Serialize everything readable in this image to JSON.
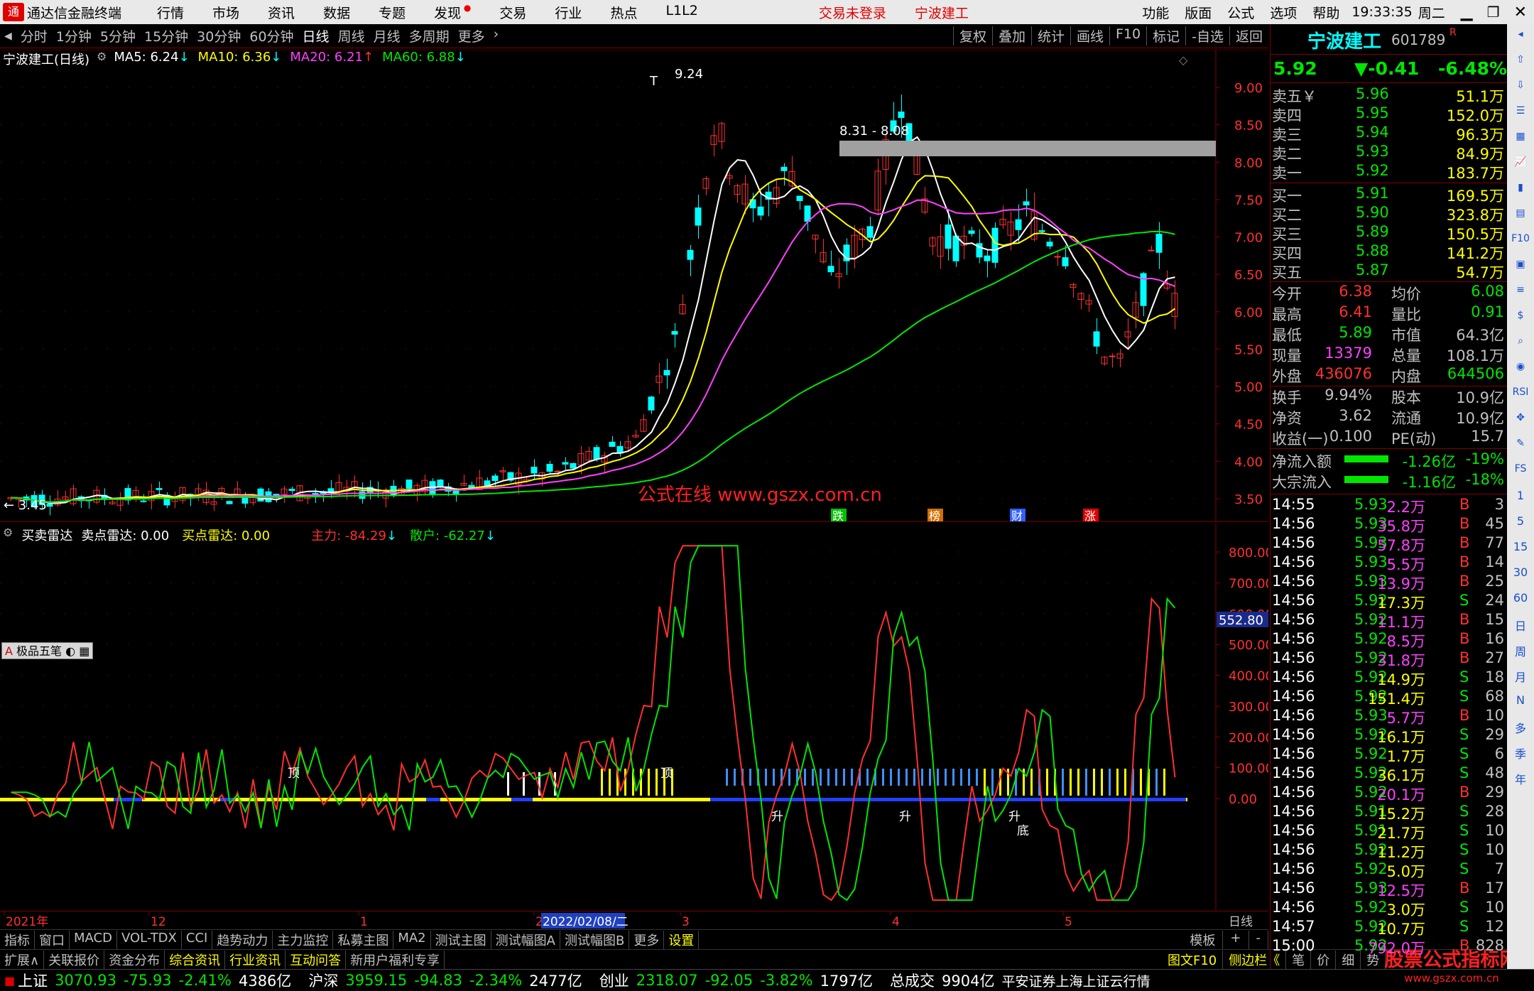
{
  "app": {
    "title": "通达信金融终端",
    "logo_icon": "tdx-logo-icon"
  },
  "menu": [
    "行情",
    "市场",
    "资讯",
    "数据",
    "专题",
    "发现",
    "交易",
    "行业",
    "热点",
    "L1L2"
  ],
  "menu_center": {
    "trade_status": "交易未登录",
    "stock_name": "宁波建工"
  },
  "menu_right": [
    "功能",
    "版面",
    "公式",
    "选项",
    "帮助"
  ],
  "clock": {
    "time": "19:33:35",
    "weekday": "周二"
  },
  "periods": [
    "分时",
    "1分钟",
    "5分钟",
    "15分钟",
    "30分钟",
    "60分钟",
    "日线",
    "周线",
    "月线",
    "多周期",
    "更多"
  ],
  "active_period": "日线",
  "toolbar_right": [
    "复权",
    "叠加",
    "统计",
    "画线",
    "F10",
    "标记",
    "-自选",
    "返回"
  ],
  "main_chart": {
    "title": "宁波建工(日线)",
    "ma_labels": [
      {
        "text": "MA5: 6.24",
        "color": "#ffffff"
      },
      {
        "text": "MA10: 6.36",
        "color": "#ffff00"
      },
      {
        "text": "MA20: 6.21",
        "color": "#ff40ff"
      },
      {
        "text": "MA60: 6.88",
        "color": "#00e600"
      }
    ],
    "y_ticks": [
      "9.00",
      "8.50",
      "8.00",
      "7.50",
      "7.00",
      "6.50",
      "6.00",
      "5.50",
      "5.00",
      "4.50",
      "4.00",
      "3.50"
    ],
    "annotations": {
      "high": "9.24",
      "low": "3.45",
      "range": "8.31 - 8.08",
      "watermark": "公式在线  www.gszx.com.cn"
    },
    "events": [
      {
        "text": "跌",
        "color": "#00c000"
      },
      {
        "text": "榜",
        "color": "#d07000"
      },
      {
        "text": "财",
        "color": "#3060ff"
      },
      {
        "text": "涨",
        "color": "#e00000"
      }
    ]
  },
  "sub_chart": {
    "title": "买卖雷达",
    "labels": [
      {
        "text": "卖点雷达: 0.00",
        "color": "#ffffff"
      },
      {
        "text": "买点雷达: 0.00",
        "color": "#ffff00"
      },
      {
        "text": "主力: -84.29",
        "color": "#ff3030"
      },
      {
        "text": "散户: -62.27",
        "color": "#00e600"
      }
    ],
    "y_ticks": [
      "800.00",
      "700.00",
      "600.00",
      "500.00",
      "400.00",
      "300.00",
      "200.00",
      "100.00",
      "0.00"
    ],
    "current_value": "552.80",
    "tool_label": "极品五笔",
    "marks": {
      "top": "顶",
      "up": "升",
      "bottom": "底"
    }
  },
  "date_axis": [
    "2021年",
    "12",
    "1",
    "2",
    "2022/02/08/二",
    "3",
    "4",
    "5"
  ],
  "date_period": "日线",
  "tabs_row1": [
    "指标",
    "窗口",
    "MACD",
    "VOL-TDX",
    "CCI",
    "趋势动力",
    "主力监控",
    "私募主图",
    "MA2",
    "测试主图",
    "测试幅图A",
    "测试幅图B",
    "更多",
    "设置"
  ],
  "tabs_row1_right": [
    "模板",
    "+",
    "-"
  ],
  "tabs_row2": [
    "扩展∧",
    "关联报价",
    "资金分布",
    "综合资讯",
    "行业资讯",
    "互动问答",
    "新用户福利专享"
  ],
  "tabs_row2_right": [
    "图文F10",
    "侧边栏《",
    "笔",
    "价",
    "细",
    "势"
  ],
  "status": {
    "sh": {
      "name": "上证",
      "price": "3070.93",
      "chg": "-75.93",
      "pct": "-2.41%",
      "amt": "4386亿"
    },
    "sz": {
      "name": "沪深",
      "price": "3959.15",
      "chg": "-94.83",
      "pct": "-2.34%",
      "amt": "2477亿"
    },
    "cy": {
      "name": "创业",
      "price": "2318.07",
      "chg": "-92.05",
      "pct": "-3.82%",
      "amt": "1797亿"
    },
    "total_label": "总成交",
    "total": "9904亿",
    "source": "平安证券上海上证云行情"
  },
  "watermark_logo": {
    "line1": "股票公式指标网",
    "line2": "www.gszx.com.cn"
  },
  "quote": {
    "name": "宁波建工",
    "code": "601789",
    "flag": "R",
    "price": "5.92",
    "change": "▼-0.41",
    "pct": "-6.48%",
    "asks": [
      {
        "label": "卖五￥",
        "price": "5.96",
        "vol": "51.1万"
      },
      {
        "label": "卖四",
        "price": "5.95",
        "vol": "152.0万"
      },
      {
        "label": "卖三",
        "price": "5.94",
        "vol": "96.3万"
      },
      {
        "label": "卖二",
        "price": "5.93",
        "vol": "84.9万"
      },
      {
        "label": "卖一",
        "price": "5.92",
        "vol": "183.7万"
      }
    ],
    "bids": [
      {
        "label": "买一",
        "price": "5.91",
        "vol": "169.5万"
      },
      {
        "label": "买二",
        "price": "5.90",
        "vol": "323.8万"
      },
      {
        "label": "买三",
        "price": "5.89",
        "vol": "150.5万"
      },
      {
        "label": "买四",
        "price": "5.88",
        "vol": "141.2万"
      },
      {
        "label": "买五",
        "price": "5.87",
        "vol": "54.7万"
      }
    ],
    "stats": [
      {
        "l1": "今开",
        "v1": "6.38",
        "c1": "#ff3030",
        "l2": "均价",
        "v2": "6.08",
        "c2": "#00e600"
      },
      {
        "l1": "最高",
        "v1": "6.41",
        "c1": "#ff3030",
        "l2": "量比",
        "v2": "0.91",
        "c2": "#00e600"
      },
      {
        "l1": "最低",
        "v1": "5.89",
        "c1": "#00e600",
        "l2": "市值",
        "v2": "64.3亿",
        "c2": "#c0c0c0"
      },
      {
        "l1": "现量",
        "v1": "13379",
        "c1": "#ff40ff",
        "l2": "总量",
        "v2": "108.1万",
        "c2": "#c0c0c0"
      },
      {
        "l1": "外盘",
        "v1": "436076",
        "c1": "#ff3030",
        "l2": "内盘",
        "v2": "644506",
        "c2": "#00e600"
      }
    ],
    "stats2": [
      {
        "l1": "换手",
        "v1": "9.94%",
        "c1": "#c0c0c0",
        "l2": "股本",
        "v2": "10.9亿",
        "c2": "#c0c0c0"
      },
      {
        "l1": "净资",
        "v1": "3.62",
        "c1": "#c0c0c0",
        "l2": "流通",
        "v2": "10.9亿",
        "c2": "#c0c0c0"
      },
      {
        "l1": "收益(一)",
        "v1": "0.100",
        "c1": "#c0c0c0",
        "l2": "PE(动)",
        "v2": "15.7",
        "c2": "#c0c0c0"
      }
    ],
    "flows": [
      {
        "label": "净流入额",
        "value": "-1.26亿",
        "pct": "-19%"
      },
      {
        "label": "大宗流入",
        "value": "-1.16亿",
        "pct": "-18%"
      }
    ],
    "ticks": [
      {
        "t": "14:55",
        "p": "5.93",
        "v": "2.2万",
        "s": "B",
        "n": "3"
      },
      {
        "t": "14:56",
        "p": "5.93",
        "v": "35.8万",
        "s": "B",
        "n": "45"
      },
      {
        "t": "14:56",
        "p": "5.93",
        "v": "57.8万",
        "s": "B",
        "n": "77"
      },
      {
        "t": "14:56",
        "p": "5.93",
        "v": "5.5万",
        "s": "B",
        "n": "14"
      },
      {
        "t": "14:56",
        "p": "5.93",
        "v": "13.9万",
        "s": "B",
        "n": "25"
      },
      {
        "t": "14:56",
        "p": "5.92",
        "v": "17.3万",
        "s": "S",
        "n": "24"
      },
      {
        "t": "14:56",
        "p": "5.92",
        "v": "11.1万",
        "s": "B",
        "n": "15"
      },
      {
        "t": "14:56",
        "p": "5.92",
        "v": "8.5万",
        "s": "B",
        "n": "16"
      },
      {
        "t": "14:56",
        "p": "5.92",
        "v": "31.8万",
        "s": "B",
        "n": "27"
      },
      {
        "t": "14:56",
        "p": "5.92",
        "v": "14.9万",
        "s": "S",
        "n": "18"
      },
      {
        "t": "14:56",
        "p": "5.92",
        "v": "151.4万",
        "s": "S",
        "n": "68"
      },
      {
        "t": "14:56",
        "p": "5.93",
        "v": "5.7万",
        "s": "B",
        "n": "10"
      },
      {
        "t": "14:56",
        "p": "5.92",
        "v": "16.1万",
        "s": "S",
        "n": "29"
      },
      {
        "t": "14:56",
        "p": "5.92",
        "v": "1.7万",
        "s": "S",
        "n": "6"
      },
      {
        "t": "14:56",
        "p": "5.92",
        "v": "36.1万",
        "s": "S",
        "n": "48"
      },
      {
        "t": "14:56",
        "p": "5.92",
        "v": "20.1万",
        "s": "B",
        "n": "29"
      },
      {
        "t": "14:56",
        "p": "5.91",
        "v": "15.2万",
        "s": "S",
        "n": "28"
      },
      {
        "t": "14:56",
        "p": "5.91",
        "v": "21.7万",
        "s": "S",
        "n": "10"
      },
      {
        "t": "14:56",
        "p": "5.92",
        "v": "11.2万",
        "s": "S",
        "n": "10"
      },
      {
        "t": "14:56",
        "p": "5.92",
        "v": "5.0万",
        "s": "S",
        "n": "7"
      },
      {
        "t": "14:56",
        "p": "5.93",
        "v": "12.5万",
        "s": "B",
        "n": "17"
      },
      {
        "t": "14:56",
        "p": "5.92",
        "v": "3.0万",
        "s": "S",
        "n": "10"
      },
      {
        "t": "14:57",
        "p": "5.92",
        "v": "10.7万",
        "s": "S",
        "n": "12"
      },
      {
        "t": "15:00",
        "p": "5.92",
        "v": "792.0万",
        "s": "B",
        "n": "828"
      }
    ]
  },
  "sidebar_icons": [
    "collapse-icon",
    "up-arrow-icon",
    "down-arrow-icon",
    "list-icon",
    "grid-icon",
    "chart-icon",
    "candle-icon",
    "report-icon",
    "f10-icon",
    "news-icon",
    "rank-icon",
    "fund-icon",
    "search-icon",
    "circle-icon",
    "rsi-icon",
    "move-icon",
    "pen-icon",
    "fs-icon",
    "1",
    "5",
    "15",
    "30",
    "60",
    "日",
    "周",
    "月",
    "N",
    "多",
    "季",
    "年"
  ],
  "colors": {
    "up": "#ff3030",
    "down": "#00ffff",
    "ma5": "#ffffff",
    "ma10": "#ffff00",
    "ma20": "#ff40ff",
    "ma60": "#00e600",
    "frame": "#800000"
  }
}
